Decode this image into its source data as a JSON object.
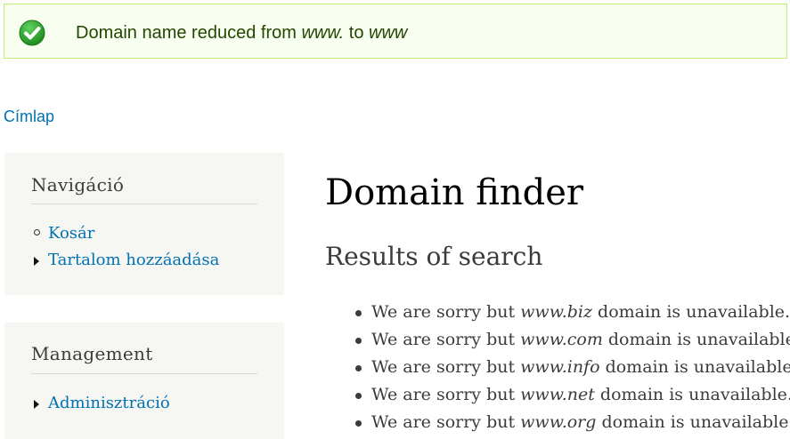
{
  "status": {
    "prefix": "Domain name reduced from ",
    "from": "www.",
    "middle": " to ",
    "to": "www",
    "colors": {
      "background": "#f8fff0",
      "border": "#bbee77",
      "text": "#234600",
      "icon": "#2fa12f"
    }
  },
  "breadcrumb": {
    "home": "Címlap"
  },
  "sidebar": {
    "navigation": {
      "title": "Navigáció",
      "items": [
        {
          "label": "Kosár",
          "bullet": "leaf"
        },
        {
          "label": "Tartalom hozzáadása",
          "bullet": "collapsed"
        }
      ]
    },
    "management": {
      "title": "Management",
      "items": [
        {
          "label": "Adminisztráció",
          "bullet": "collapsed"
        }
      ]
    }
  },
  "main": {
    "title": "Domain finder",
    "subtitle": "Results of search",
    "results": [
      {
        "before": "We are sorry but ",
        "domain": "www.biz",
        "after": " domain is unavailable."
      },
      {
        "before": "We are sorry but ",
        "domain": "www.com",
        "after": " domain is unavailable."
      },
      {
        "before": "We are sorry but ",
        "domain": "www.info",
        "after": " domain is unavailable."
      },
      {
        "before": "We are sorry but ",
        "domain": "www.net",
        "after": " domain is unavailable."
      },
      {
        "before": "We are sorry but ",
        "domain": "www.org",
        "after": " domain is unavailable."
      }
    ]
  },
  "colors": {
    "link": "#0071b3",
    "sidebar_bg": "#f6f6f2"
  }
}
